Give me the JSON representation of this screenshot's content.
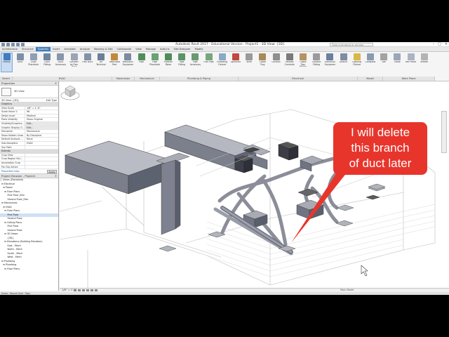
{
  "window": {
    "title": "Autodesk Revit 2017 - Educational Version - Project1 - 3D View: {3D}",
    "search_placeholder": "Type a keyword or phrase",
    "controls": [
      "–",
      "□",
      "✕"
    ]
  },
  "tabs": [
    "Architecture",
    "Structure",
    "Systems",
    "Insert",
    "Annotate",
    "Analyze",
    "Massing & Site",
    "Collaborate",
    "View",
    "Manage",
    "Add-Ins",
    "Site Designer",
    "Modify"
  ],
  "active_tab": "Systems",
  "ribbon": {
    "buttons": [
      {
        "label": "Modify",
        "color": "#3f7cc0"
      },
      {
        "label": "Duct",
        "color": "#7d8fa6"
      },
      {
        "label": "Duct Placeholder",
        "color": "#8fa0b4"
      },
      {
        "label": "Duct Fitting",
        "color": "#6f86a2"
      },
      {
        "label": "Duct Accessory",
        "color": "#8796aa"
      },
      {
        "label": "Convert to Flex Duct",
        "color": "#9aa6b6"
      },
      {
        "label": "Flex Duct",
        "color": "#8193aa"
      },
      {
        "label": "Air Terminal",
        "color": "#6c7f99"
      },
      {
        "label": "Fabrication Part",
        "color": "#c08a3a"
      },
      {
        "label": "Mechanical Equipment",
        "color": "#7b8a9e"
      },
      {
        "label": "Pipe",
        "color": "#4f8e5a"
      },
      {
        "label": "Pipe Placeholder",
        "color": "#6aa274"
      },
      {
        "label": "Parallel Pipes",
        "color": "#4e8c58"
      },
      {
        "label": "Pipe Fitting",
        "color": "#5b9466"
      },
      {
        "label": "Pipe Accessory",
        "color": "#6a9a72"
      },
      {
        "label": "Flex Pipe",
        "color": "#77a67e"
      },
      {
        "label": "Plumbing Fixture",
        "color": "#8aa9c6"
      },
      {
        "label": "Sprinkler",
        "color": "#c04a3f"
      },
      {
        "label": "Wire",
        "color": "#9a9a9a"
      },
      {
        "label": "Cable Tray",
        "color": "#a78a5a"
      },
      {
        "label": "Conduit",
        "color": "#8f8f8f"
      },
      {
        "label": "Parallel Conduits",
        "color": "#7a7a7a"
      },
      {
        "label": "Cable Tray Fitting",
        "color": "#b49463"
      },
      {
        "label": "Conduit Fitting",
        "color": "#9b9b9b"
      },
      {
        "label": "Electrical Equipment",
        "color": "#6d7fa0"
      },
      {
        "label": "Device",
        "color": "#7f8ca4"
      },
      {
        "label": "Lighting Fixture",
        "color": "#d8b84a"
      },
      {
        "label": "Component",
        "color": "#8a9ab0"
      },
      {
        "label": "Set",
        "color": "#a3a3a3"
      },
      {
        "label": "Show",
        "color": "#9aa7b8"
      },
      {
        "label": "Ref Plane",
        "color": "#aab4c2"
      },
      {
        "label": "Viewer",
        "color": "#b3b3b3"
      }
    ],
    "panels": [
      "Select",
      "HVAC",
      "Fabrication",
      "Mechanical",
      "Plumbing & Piping",
      "Electrical",
      "Model",
      "Work Plane"
    ]
  },
  "properties": {
    "header": "Properties",
    "type_name": "3D View",
    "instance_selector": "3D View: {3D}",
    "edit_type": "Edit Type",
    "sections": [
      {
        "name": "Graphics",
        "rows": [
          {
            "k": "View Scale",
            "v": "1/8\" = 1'-0\""
          },
          {
            "k": "Scale Value 1:",
            "v": "96"
          },
          {
            "k": "Detail Level",
            "v": "Medium"
          },
          {
            "k": "Parts Visibility",
            "v": "Show Original"
          },
          {
            "k": "Visibility/Graphics...",
            "v": "Edit..."
          },
          {
            "k": "Graphic Display O...",
            "v": "Edit..."
          },
          {
            "k": "Discipline",
            "v": "Mechanical"
          },
          {
            "k": "Show Hidden Lines",
            "v": "By Discipline"
          },
          {
            "k": "Default Analysis ...",
            "v": "None"
          },
          {
            "k": "Sub-Discipline",
            "v": "HVAC"
          },
          {
            "k": "Sun Path",
            "v": ""
          }
        ]
      },
      {
        "name": "Extents",
        "rows": [
          {
            "k": "Crop View",
            "v": ""
          },
          {
            "k": "Crop Region Visi...",
            "v": ""
          },
          {
            "k": "Annotation Crop",
            "v": ""
          },
          {
            "k": "Far Clip Active",
            "v": ""
          }
        ]
      }
    ],
    "help_link": "Properties help",
    "apply": "Apply"
  },
  "browser": {
    "header": "Project Browser - Project1",
    "items": [
      "□ Views (Discipline)",
      "  ⊟ Electrical",
      "    ⊟ Power",
      "      ⊟ Floor Plans",
      "          First Floor_Elec",
      "          Second Floor_Elec",
      "  ⊟ Mechanical",
      "    ⊟ HVAC",
      "      ⊟ Floor Plans",
      "          First Floor",
      "          Second Floor",
      "      ⊟ Ceiling Plans",
      "          First Floor",
      "          Second Floor",
      "      ⊟ 3D Views",
      "          {3D}",
      "      ⊟ Elevations (Building Elevation)",
      "          East - Mech",
      "          North - Mech",
      "          South - Mech",
      "          West - Mech",
      "  ⊟ Plumbing",
      "    ⊟ Plumbing",
      "      ⊟ Floor Plans"
    ],
    "selected_index": 9
  },
  "viewport": {
    "callout": "I will delete\nthis branch\nof duct later",
    "callout_color": "#e8352c",
    "view_scale": "1/8\" = 1'-0\"",
    "select_filter": "Main Model"
  },
  "statusbar": {
    "text": "Ducts : Round Duct : Taps"
  }
}
